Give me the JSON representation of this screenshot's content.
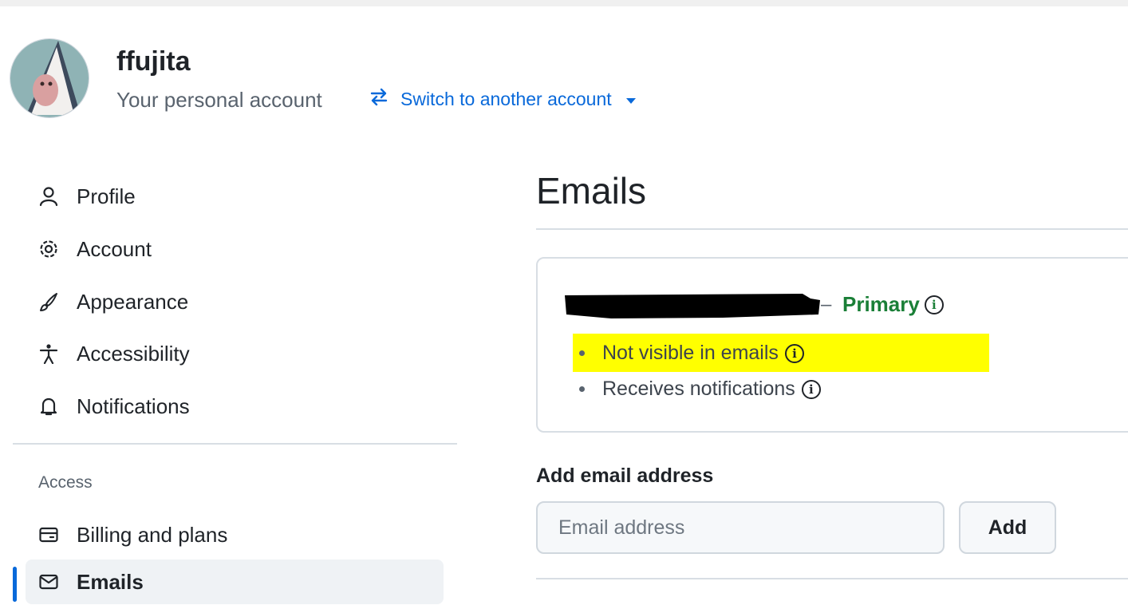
{
  "header": {
    "username": "ffujita",
    "subtitle": "Your personal account",
    "switch_label": "Switch to another account"
  },
  "sidebar": {
    "items": [
      {
        "label": "Profile",
        "icon": "person-icon"
      },
      {
        "label": "Account",
        "icon": "gear-icon"
      },
      {
        "label": "Appearance",
        "icon": "paintbrush-icon"
      },
      {
        "label": "Accessibility",
        "icon": "accessibility-icon"
      },
      {
        "label": "Notifications",
        "icon": "bell-icon"
      }
    ],
    "access_heading": "Access",
    "access_items": [
      {
        "label": "Billing and plans",
        "icon": "credit-card-icon"
      },
      {
        "label": "Emails",
        "icon": "mail-icon",
        "active": true
      }
    ]
  },
  "main": {
    "title": "Emails",
    "email_card": {
      "primary_label": "Primary",
      "bullets": [
        "Not visible in emails",
        "Receives notifications"
      ]
    },
    "add_email": {
      "heading": "Add email address",
      "placeholder": "Email address",
      "button_label": "Add"
    }
  },
  "colors": {
    "accent": "#0969da",
    "primary_green": "#1a7f37",
    "highlight": "#ffff00"
  }
}
